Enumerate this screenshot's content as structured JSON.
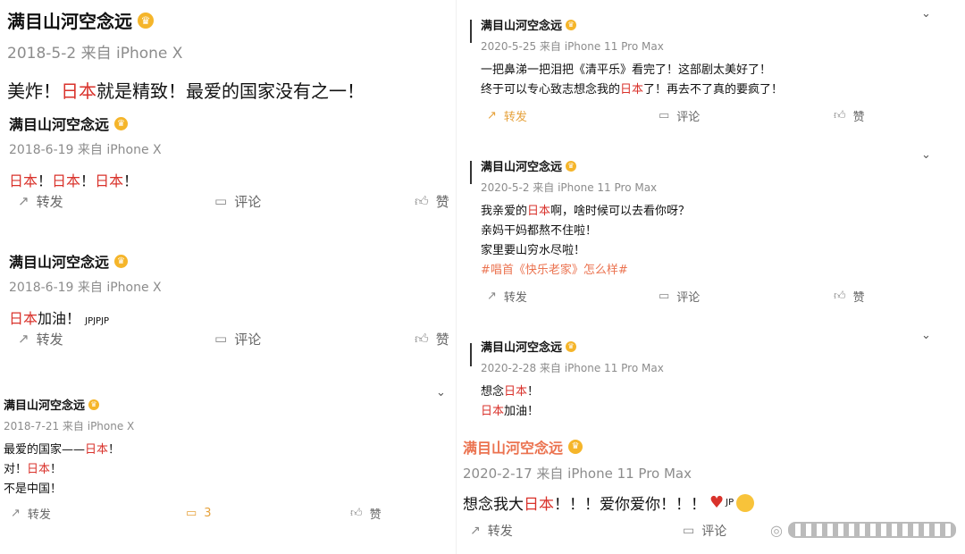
{
  "posts": [
    {
      "name": "满目山河空念远",
      "meta": "2018-5-2 来自 iPhone X",
      "line1": {
        "pre": "美炸！",
        "red": "日本",
        "post": "就是精致！最爱的国家没有之一！"
      }
    },
    {
      "name": "满目山河空念远",
      "meta": "2018-6-19 来自 iPhone X",
      "line1": {
        "r1": "日本",
        "t1": "！",
        "r2": "日本",
        "t2": "！",
        "r3": "日本",
        "t3": "！"
      },
      "actions": {
        "repost": "转发",
        "comment": "评论",
        "like": "赞"
      }
    },
    {
      "name": "满目山河空念远",
      "meta": "2018-6-19 来自 iPhone X",
      "line1": {
        "red": "日本",
        "post": "加油！",
        "small": "JPJPJP"
      },
      "actions": {
        "repost": "转发",
        "comment": "评论",
        "like": "赞"
      }
    },
    {
      "name": "满目山河空念远",
      "meta": "2018-7-21 来自 iPhone X",
      "lines": [
        {
          "pre": "最爱的国家——",
          "red": "日本",
          "post": "！"
        },
        {
          "pre": "对！",
          "red": "日本",
          "post": "！"
        },
        {
          "pre": "不是中国！"
        }
      ],
      "actions": {
        "repost": "转发",
        "comment": "3",
        "like": "赞"
      }
    },
    {
      "name": "满目山河空念远",
      "meta": "2020-5-25 来自 iPhone 11 Pro Max",
      "lines": [
        {
          "pre": "一把鼻涕一把泪把《清平乐》看完了！这部剧太美好了！"
        },
        {
          "pre": "终于可以专心致志想念我的",
          "red": "日本",
          "post": "了！再去不了真的要疯了！"
        }
      ],
      "actions": {
        "repost": "转发",
        "comment": "评论",
        "like": "赞"
      }
    },
    {
      "name": "满目山河空念远",
      "meta": "2020-5-2 来自 iPhone 11 Pro Max",
      "lines": [
        {
          "pre": "我亲爱的",
          "red": "日本",
          "post": "啊，啥时候可以去看你呀？"
        },
        {
          "pre": "亲妈干妈都熬不住啦！"
        },
        {
          "pre": "家里要山穷水尽啦！"
        },
        {
          "tag": "#唱首《快乐老家》怎么样#"
        }
      ],
      "actions": {
        "repost": "转发",
        "comment": "评论",
        "like": "赞"
      }
    },
    {
      "name": "满目山河空念远",
      "meta": "2020-2-28 来自 iPhone 11 Pro Max",
      "lines": [
        {
          "pre": "想念",
          "red": "日本",
          "post": "！"
        },
        {
          "red": "日本",
          "post": "加油！"
        }
      ]
    },
    {
      "name": "满目山河空念远",
      "meta": "2020-2-17 来自 iPhone 11 Pro Max",
      "line1": {
        "pre": "想念我大",
        "red": "日本",
        "post": "！！！爱你爱你！！！",
        "small": "JP"
      },
      "actions": {
        "repost": "转发",
        "comment": "评论"
      }
    }
  ],
  "icons": {
    "crown": "crown-badge-icon",
    "repost": "repost-icon",
    "comment": "comment-icon",
    "like": "like-icon",
    "chevron": "chevron-down-icon",
    "heart": "heart-icon",
    "emoji": "kiss-emoji-icon"
  },
  "colors": {
    "red": "#d9322b",
    "hashtag": "#eb7350",
    "crown": "#f5b52a",
    "name_orange": "#eb7350"
  }
}
